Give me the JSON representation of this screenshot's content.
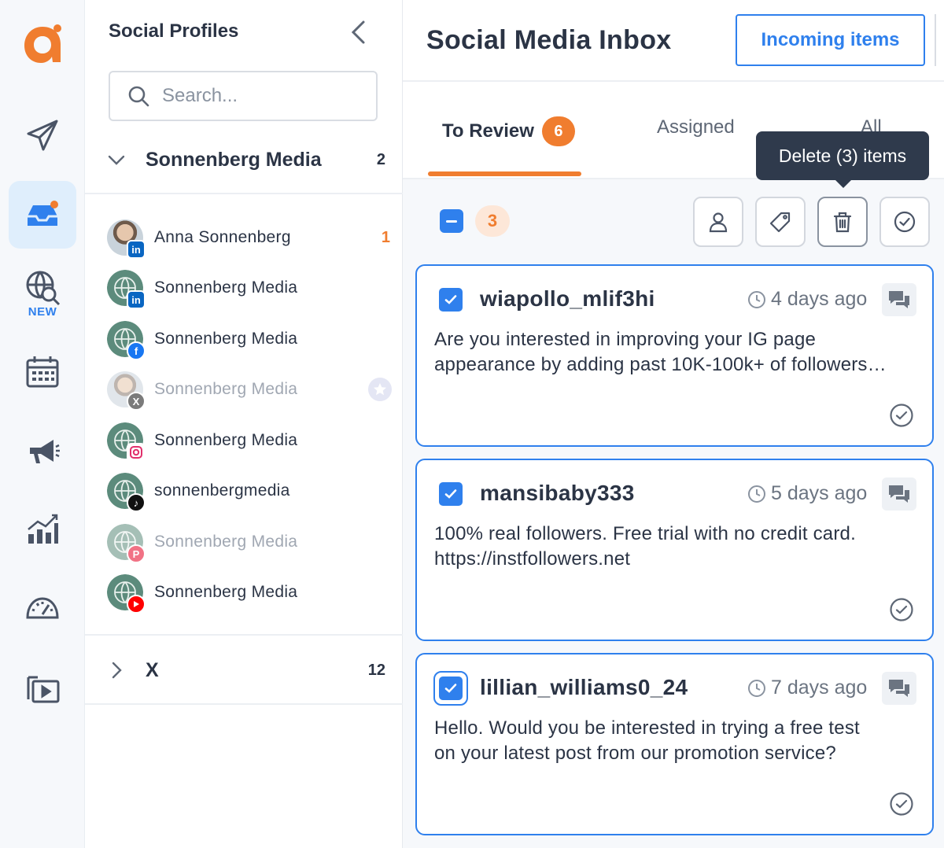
{
  "app": {
    "logo_letter": "a",
    "nav": [
      {
        "icon": "paper-plane-icon"
      },
      {
        "icon": "inbox-icon",
        "active": true
      },
      {
        "icon": "globe-search-icon",
        "badge": "NEW"
      },
      {
        "icon": "calendar-icon"
      },
      {
        "icon": "megaphone-icon"
      },
      {
        "icon": "bar-chart-icon"
      },
      {
        "icon": "speedometer-icon"
      },
      {
        "icon": "video-library-icon"
      }
    ]
  },
  "profiles": {
    "title": "Social Profiles",
    "search_placeholder": "Search...",
    "groups": [
      {
        "name": "Sonnenberg Media",
        "count": "2",
        "expanded": true
      },
      {
        "name": "X",
        "count": "12",
        "expanded": false
      }
    ],
    "items": [
      {
        "name": "Anna Sonnenberg",
        "network": "linkedin",
        "count": "1",
        "dim": false
      },
      {
        "name": "Sonnenberg Media",
        "network": "linkedin",
        "count": "",
        "dim": false
      },
      {
        "name": "Sonnenberg Media",
        "network": "facebook",
        "count": "",
        "dim": false
      },
      {
        "name": "Sonnenberg Media",
        "network": "x",
        "count": "",
        "dim": true,
        "starred": true
      },
      {
        "name": "Sonnenberg Media",
        "network": "instagram",
        "count": "",
        "dim": false
      },
      {
        "name": "sonnenbergmedia",
        "network": "tiktok",
        "count": "",
        "dim": false
      },
      {
        "name": "Sonnenberg Media",
        "network": "pinterest",
        "count": "",
        "dim": true
      },
      {
        "name": "Sonnenberg Media",
        "network": "youtube",
        "count": "",
        "dim": false
      }
    ]
  },
  "main": {
    "title": "Social Media Inbox",
    "incoming_button": "Incoming items",
    "tabs": [
      {
        "label": "To Review",
        "badge": "6",
        "active": true
      },
      {
        "label": "Assigned",
        "active": false
      },
      {
        "label": "All",
        "active": false
      }
    ],
    "tooltip": "Delete (3) items",
    "selected_count": "3",
    "cards": [
      {
        "user": "wiapollo_mlif3hi",
        "time": "4 days ago",
        "text_line1": "Are you interested in improving your IG page",
        "text_line2": "appearance by adding past 10K-100k+ of followers…"
      },
      {
        "user": "mansibaby333",
        "time": "5 days ago",
        "text_line1": "100% real followers.  Free trial with no credit card.",
        "text_line2": "https://instfollowers.net"
      },
      {
        "user": "lillian_williams0_24",
        "time": "7 days ago",
        "text_line1": "Hello. Would you be interested in trying a free test",
        "text_line2": "on your latest post from our promotion service?"
      }
    ]
  },
  "colors": {
    "accent": "#2f80ed",
    "brand_orange": "#f07d2f",
    "tooltip_bg": "#2f3a4c"
  }
}
